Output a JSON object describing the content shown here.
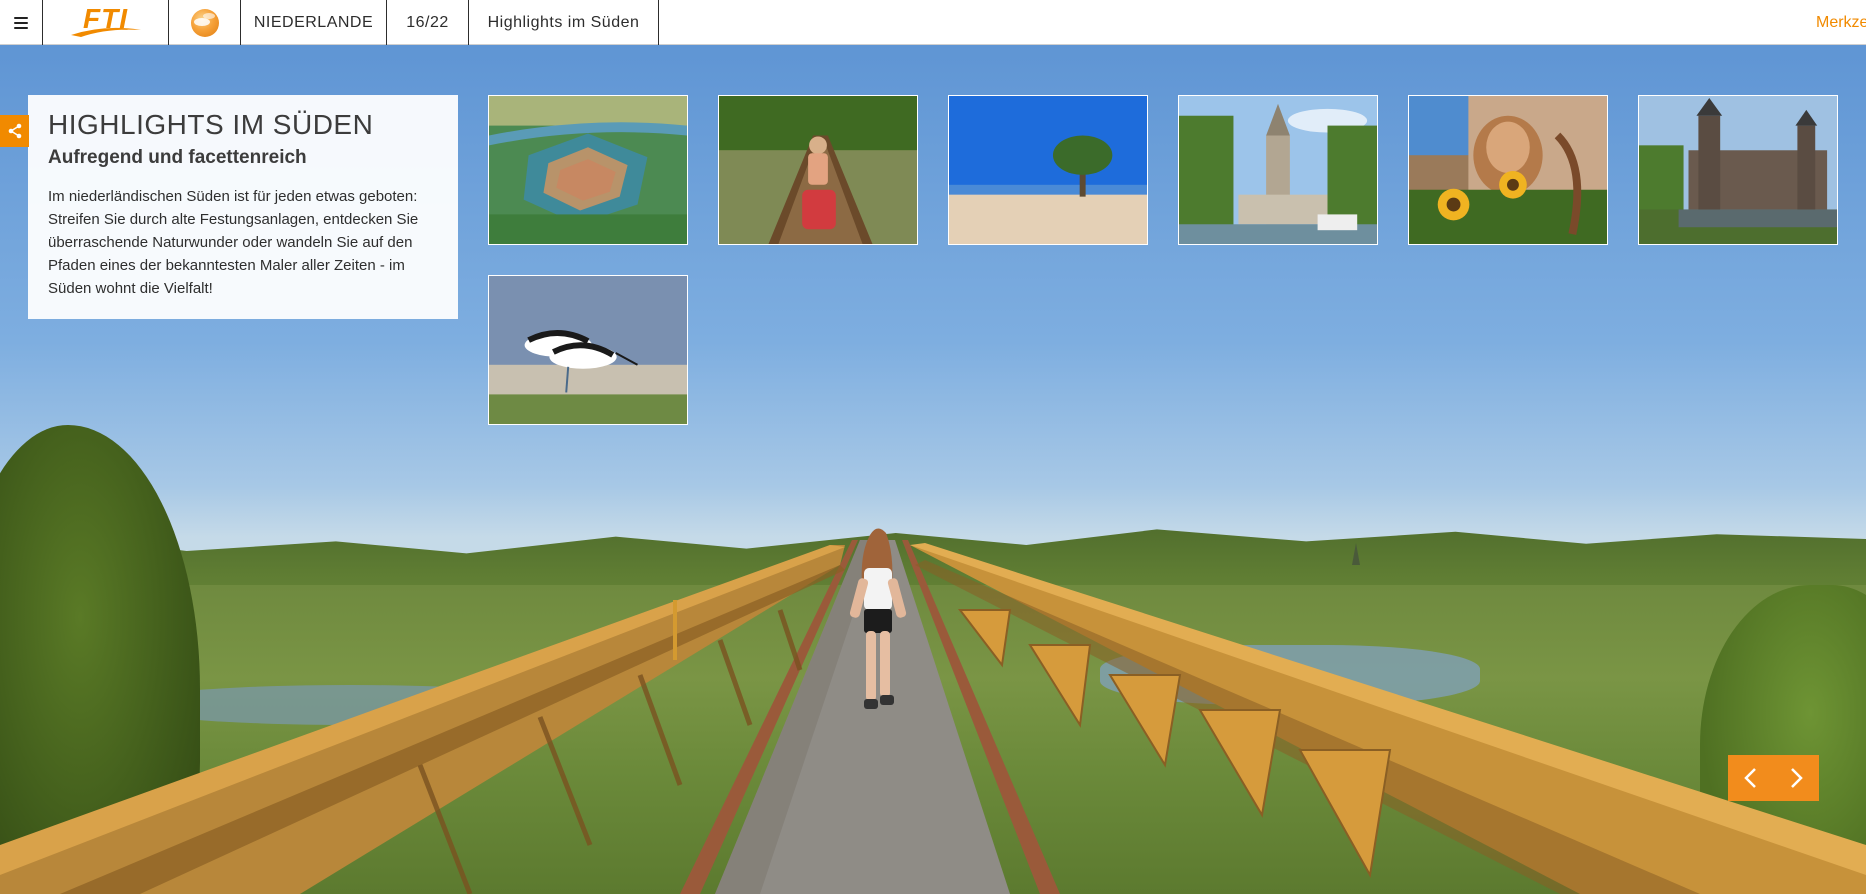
{
  "topbar": {
    "menu_icon": "hamburger-icon",
    "logo_text": "FTI",
    "globe_icon": "globe-icon",
    "country": "NIEDERLANDE",
    "page_indicator": "16/22",
    "chapter": "Highlights im Süden",
    "merkzettel": "Merkze"
  },
  "info": {
    "title": "HIGHLIGHTS IM SÜDEN",
    "subtitle": "Aufregend und facettenreich",
    "body": "Im niederländischen Süden ist für jeden etwas geboten: Streifen Sie durch alte Festungsanlagen, entdecken Sie überraschende Naturwunder oder wandeln Sie auf den Pfaden eines der bekanntesten Maler aller Zeiten - im Süden wohnt die Vielfalt!"
  },
  "share_icon": "share-icon",
  "gallery": [
    {
      "name": "fortress-aerial"
    },
    {
      "name": "canoe"
    },
    {
      "name": "beach-tree"
    },
    {
      "name": "church-canal"
    },
    {
      "name": "sunflowers-mural"
    },
    {
      "name": "castle"
    },
    {
      "name": "avocet-birds"
    }
  ],
  "navigation": {
    "prev_icon": "chevron-left-icon",
    "next_icon": "chevron-right-icon"
  },
  "colors": {
    "accent": "#f18a00",
    "panel": "#ffffff",
    "text": "#3c3c3c"
  }
}
